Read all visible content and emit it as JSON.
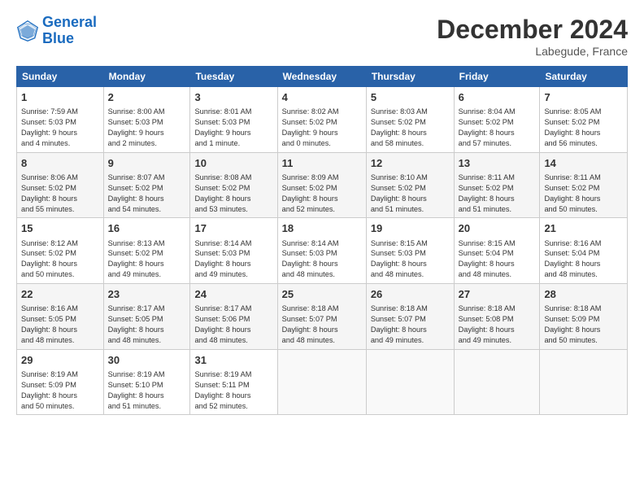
{
  "header": {
    "logo_general": "General",
    "logo_blue": "Blue",
    "title": "December 2024",
    "subtitle": "Labegude, France"
  },
  "weekdays": [
    "Sunday",
    "Monday",
    "Tuesday",
    "Wednesday",
    "Thursday",
    "Friday",
    "Saturday"
  ],
  "weeks": [
    [
      {
        "day": "1",
        "lines": [
          "Sunrise: 7:59 AM",
          "Sunset: 5:03 PM",
          "Daylight: 9 hours",
          "and 4 minutes."
        ]
      },
      {
        "day": "2",
        "lines": [
          "Sunrise: 8:00 AM",
          "Sunset: 5:03 PM",
          "Daylight: 9 hours",
          "and 2 minutes."
        ]
      },
      {
        "day": "3",
        "lines": [
          "Sunrise: 8:01 AM",
          "Sunset: 5:03 PM",
          "Daylight: 9 hours",
          "and 1 minute."
        ]
      },
      {
        "day": "4",
        "lines": [
          "Sunrise: 8:02 AM",
          "Sunset: 5:02 PM",
          "Daylight: 9 hours",
          "and 0 minutes."
        ]
      },
      {
        "day": "5",
        "lines": [
          "Sunrise: 8:03 AM",
          "Sunset: 5:02 PM",
          "Daylight: 8 hours",
          "and 58 minutes."
        ]
      },
      {
        "day": "6",
        "lines": [
          "Sunrise: 8:04 AM",
          "Sunset: 5:02 PM",
          "Daylight: 8 hours",
          "and 57 minutes."
        ]
      },
      {
        "day": "7",
        "lines": [
          "Sunrise: 8:05 AM",
          "Sunset: 5:02 PM",
          "Daylight: 8 hours",
          "and 56 minutes."
        ]
      }
    ],
    [
      {
        "day": "8",
        "lines": [
          "Sunrise: 8:06 AM",
          "Sunset: 5:02 PM",
          "Daylight: 8 hours",
          "and 55 minutes."
        ]
      },
      {
        "day": "9",
        "lines": [
          "Sunrise: 8:07 AM",
          "Sunset: 5:02 PM",
          "Daylight: 8 hours",
          "and 54 minutes."
        ]
      },
      {
        "day": "10",
        "lines": [
          "Sunrise: 8:08 AM",
          "Sunset: 5:02 PM",
          "Daylight: 8 hours",
          "and 53 minutes."
        ]
      },
      {
        "day": "11",
        "lines": [
          "Sunrise: 8:09 AM",
          "Sunset: 5:02 PM",
          "Daylight: 8 hours",
          "and 52 minutes."
        ]
      },
      {
        "day": "12",
        "lines": [
          "Sunrise: 8:10 AM",
          "Sunset: 5:02 PM",
          "Daylight: 8 hours",
          "and 51 minutes."
        ]
      },
      {
        "day": "13",
        "lines": [
          "Sunrise: 8:11 AM",
          "Sunset: 5:02 PM",
          "Daylight: 8 hours",
          "and 51 minutes."
        ]
      },
      {
        "day": "14",
        "lines": [
          "Sunrise: 8:11 AM",
          "Sunset: 5:02 PM",
          "Daylight: 8 hours",
          "and 50 minutes."
        ]
      }
    ],
    [
      {
        "day": "15",
        "lines": [
          "Sunrise: 8:12 AM",
          "Sunset: 5:02 PM",
          "Daylight: 8 hours",
          "and 50 minutes."
        ]
      },
      {
        "day": "16",
        "lines": [
          "Sunrise: 8:13 AM",
          "Sunset: 5:02 PM",
          "Daylight: 8 hours",
          "and 49 minutes."
        ]
      },
      {
        "day": "17",
        "lines": [
          "Sunrise: 8:14 AM",
          "Sunset: 5:03 PM",
          "Daylight: 8 hours",
          "and 49 minutes."
        ]
      },
      {
        "day": "18",
        "lines": [
          "Sunrise: 8:14 AM",
          "Sunset: 5:03 PM",
          "Daylight: 8 hours",
          "and 48 minutes."
        ]
      },
      {
        "day": "19",
        "lines": [
          "Sunrise: 8:15 AM",
          "Sunset: 5:03 PM",
          "Daylight: 8 hours",
          "and 48 minutes."
        ]
      },
      {
        "day": "20",
        "lines": [
          "Sunrise: 8:15 AM",
          "Sunset: 5:04 PM",
          "Daylight: 8 hours",
          "and 48 minutes."
        ]
      },
      {
        "day": "21",
        "lines": [
          "Sunrise: 8:16 AM",
          "Sunset: 5:04 PM",
          "Daylight: 8 hours",
          "and 48 minutes."
        ]
      }
    ],
    [
      {
        "day": "22",
        "lines": [
          "Sunrise: 8:16 AM",
          "Sunset: 5:05 PM",
          "Daylight: 8 hours",
          "and 48 minutes."
        ]
      },
      {
        "day": "23",
        "lines": [
          "Sunrise: 8:17 AM",
          "Sunset: 5:05 PM",
          "Daylight: 8 hours",
          "and 48 minutes."
        ]
      },
      {
        "day": "24",
        "lines": [
          "Sunrise: 8:17 AM",
          "Sunset: 5:06 PM",
          "Daylight: 8 hours",
          "and 48 minutes."
        ]
      },
      {
        "day": "25",
        "lines": [
          "Sunrise: 8:18 AM",
          "Sunset: 5:07 PM",
          "Daylight: 8 hours",
          "and 48 minutes."
        ]
      },
      {
        "day": "26",
        "lines": [
          "Sunrise: 8:18 AM",
          "Sunset: 5:07 PM",
          "Daylight: 8 hours",
          "and 49 minutes."
        ]
      },
      {
        "day": "27",
        "lines": [
          "Sunrise: 8:18 AM",
          "Sunset: 5:08 PM",
          "Daylight: 8 hours",
          "and 49 minutes."
        ]
      },
      {
        "day": "28",
        "lines": [
          "Sunrise: 8:18 AM",
          "Sunset: 5:09 PM",
          "Daylight: 8 hours",
          "and 50 minutes."
        ]
      }
    ],
    [
      {
        "day": "29",
        "lines": [
          "Sunrise: 8:19 AM",
          "Sunset: 5:09 PM",
          "Daylight: 8 hours",
          "and 50 minutes."
        ]
      },
      {
        "day": "30",
        "lines": [
          "Sunrise: 8:19 AM",
          "Sunset: 5:10 PM",
          "Daylight: 8 hours",
          "and 51 minutes."
        ]
      },
      {
        "day": "31",
        "lines": [
          "Sunrise: 8:19 AM",
          "Sunset: 5:11 PM",
          "Daylight: 8 hours",
          "and 52 minutes."
        ]
      },
      null,
      null,
      null,
      null
    ]
  ]
}
